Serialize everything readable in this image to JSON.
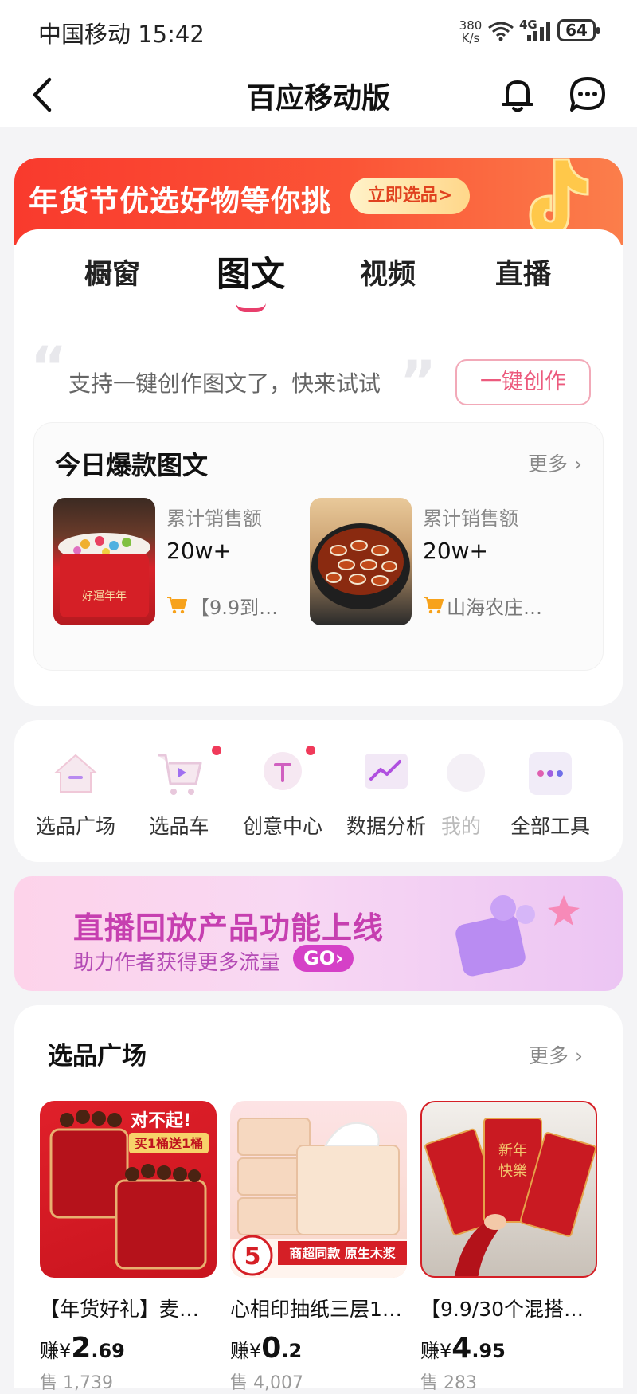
{
  "status_bar": {
    "carrier_time": "中国移动 15:42",
    "net_speed": "380 K/s",
    "network": "4G",
    "battery": "64"
  },
  "nav": {
    "title": "百应移动版",
    "back_icon": "chevron-left-icon",
    "bell_icon": "bell-icon",
    "message_icon": "chat-bubble-icon"
  },
  "promo_banner": {
    "text": "年货节优选好物等你挑",
    "button": "立即选品>"
  },
  "content_tabs": {
    "items": [
      "橱窗",
      "图文",
      "视频",
      "直播"
    ],
    "active": "图文"
  },
  "create_hint": {
    "text": "支持一键创作图文了，快来试试",
    "button": "一键创作"
  },
  "hot_posts": {
    "title": "今日爆款图文",
    "more": "更多 ›",
    "items": [
      {
        "label": "累计销售额",
        "value": "20w+",
        "shop": "【9.9到…"
      },
      {
        "label": "累计销售额",
        "value": "20w+",
        "shop": "山海农庄…"
      }
    ]
  },
  "tools": {
    "items": [
      {
        "label": "选品广场",
        "icon": "house-icon",
        "badge": false
      },
      {
        "label": "选品车",
        "icon": "cart-icon",
        "badge": true
      },
      {
        "label": "创意中心",
        "icon": "bulb-icon",
        "badge": true
      },
      {
        "label": "数据分析",
        "icon": "chart-icon",
        "badge": false
      },
      {
        "label": "我的",
        "icon": "user-icon",
        "badge": false
      },
      {
        "label": "全部工具",
        "icon": "more-dots-icon",
        "badge": false
      }
    ]
  },
  "live_banner": {
    "title": "直播回放产品功能上线",
    "subtitle": "助力作者获得更多流量",
    "button": "GO›"
  },
  "plaza": {
    "title": "选品广场",
    "more": "更多 ›",
    "products": [
      {
        "name": "【年货好礼】麦…",
        "earn_prefix": "赚¥",
        "earn_int": "2",
        "earn_dec": ".69",
        "sold": "售 1,739"
      },
      {
        "name": "心相印抽纸三层1…",
        "earn_prefix": "赚¥",
        "earn_int": "0",
        "earn_dec": ".2",
        "sold": "售 4,007"
      },
      {
        "name": "【9.9/30个混搭…",
        "earn_prefix": "赚¥",
        "earn_int": "4",
        "earn_dec": ".95",
        "sold": "售 283"
      }
    ]
  },
  "colors": {
    "accent_pink": "#ec5a7d",
    "banner_red": "#f93a2d",
    "live_purple": "#c63fb0"
  }
}
